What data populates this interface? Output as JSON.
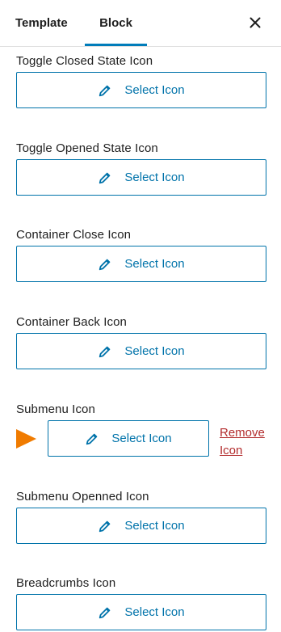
{
  "tabs": {
    "template": "Template",
    "block": "Block"
  },
  "close_label": "×",
  "fields": [
    {
      "label": "Toggle Closed State Icon",
      "button": "Select Icon"
    },
    {
      "label": "Toggle Opened State Icon",
      "button": "Select Icon"
    },
    {
      "label": "Container Close Icon",
      "button": "Select Icon"
    },
    {
      "label": "Container Back Icon",
      "button": "Select Icon"
    },
    {
      "label": "Submenu Icon",
      "button": "Select Icon",
      "remove": "Remove Icon"
    },
    {
      "label": "Submenu Openned Icon",
      "button": "Select Icon"
    },
    {
      "label": "Breadcrumbs Icon",
      "button": "Select Icon"
    }
  ],
  "colors": {
    "accent": "#0073aa",
    "remove": "#b32d2e",
    "marker": "#f07b00"
  }
}
